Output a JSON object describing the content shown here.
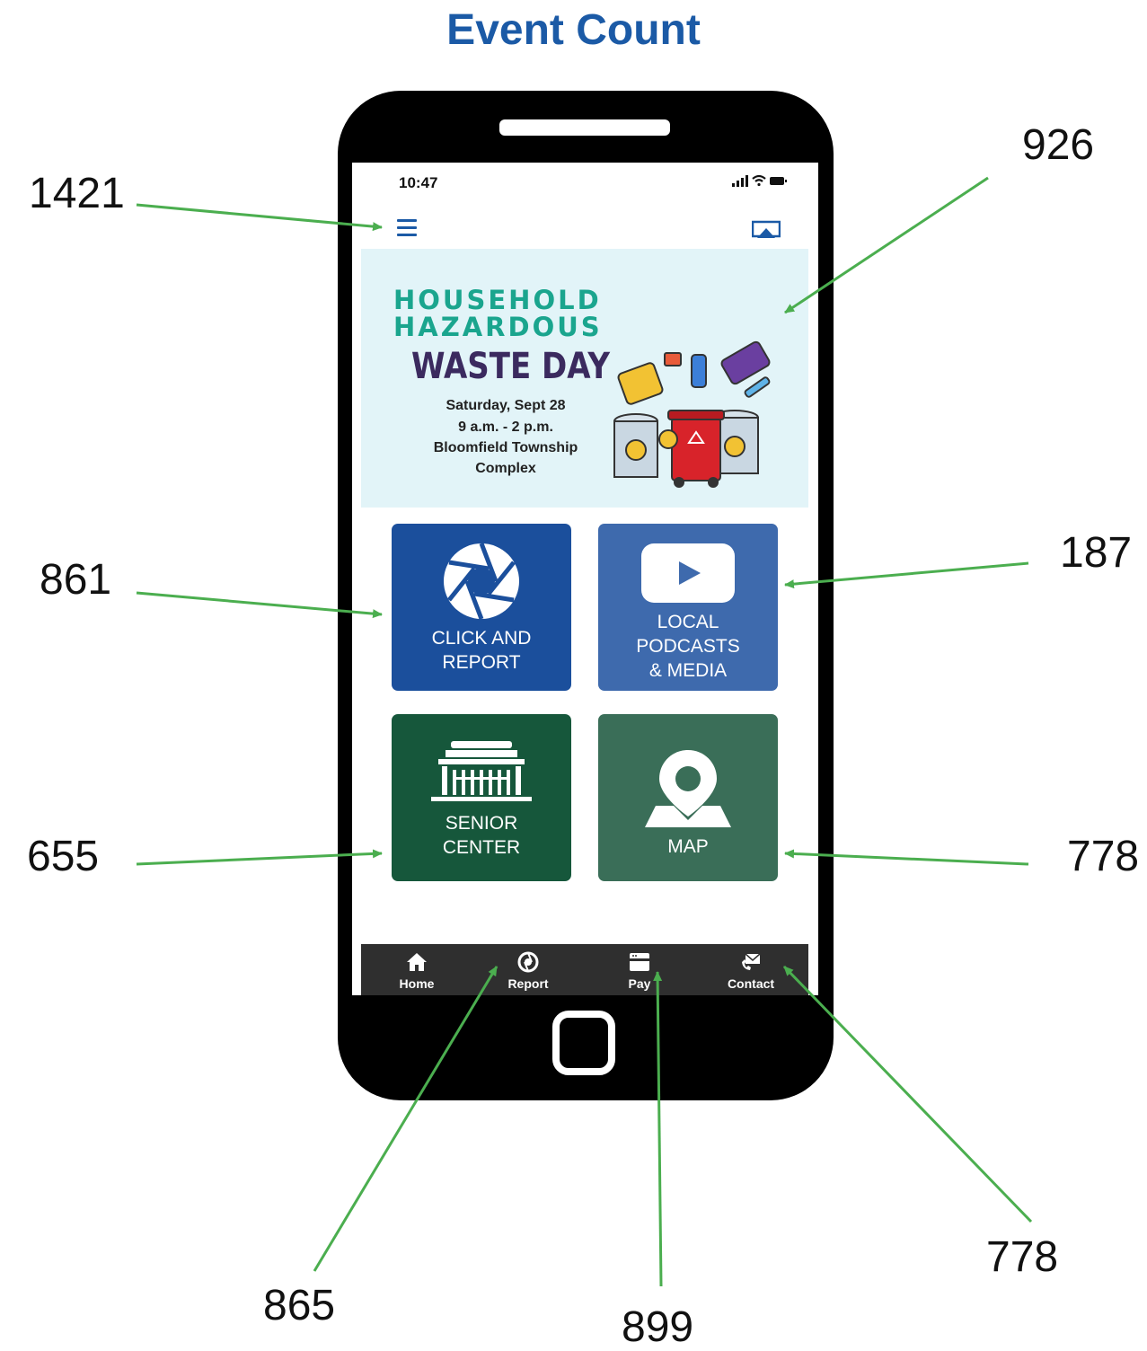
{
  "title": "Event Count",
  "counts": {
    "menu": "1421",
    "banner": "926",
    "click_report": "861",
    "podcasts": "187",
    "senior_center": "655",
    "map": "778",
    "tab_report": "865",
    "tab_pay": "899",
    "tab_contact": "778"
  },
  "phone": {
    "status_time": "10:47",
    "banner": {
      "line1": "HOUSEHOLD",
      "line2": "HAZARDOUS",
      "line3": "WASTE DAY",
      "date": "Saturday, Sept 28",
      "time": "9 a.m. - 2 p.m.",
      "place1": "Bloomfield Township",
      "place2": "Complex"
    },
    "tiles": {
      "click_report": {
        "line1": "CLICK AND",
        "line2": "REPORT",
        "color": "#1b4f9c"
      },
      "podcasts": {
        "line1": "LOCAL",
        "line2": "PODCASTS",
        "line3": "& MEDIA",
        "color": "#3e6aad"
      },
      "senior_center": {
        "line1": "SENIOR",
        "line2": "CENTER",
        "color": "#16573b"
      },
      "map": {
        "line1": "MAP",
        "color": "#3a6e58"
      }
    },
    "tabs": {
      "home": "Home",
      "report": "Report",
      "pay": "Pay",
      "contact": "Contact"
    }
  },
  "colors": {
    "title": "#1b5aa6",
    "arrow": "#4bae4f"
  }
}
